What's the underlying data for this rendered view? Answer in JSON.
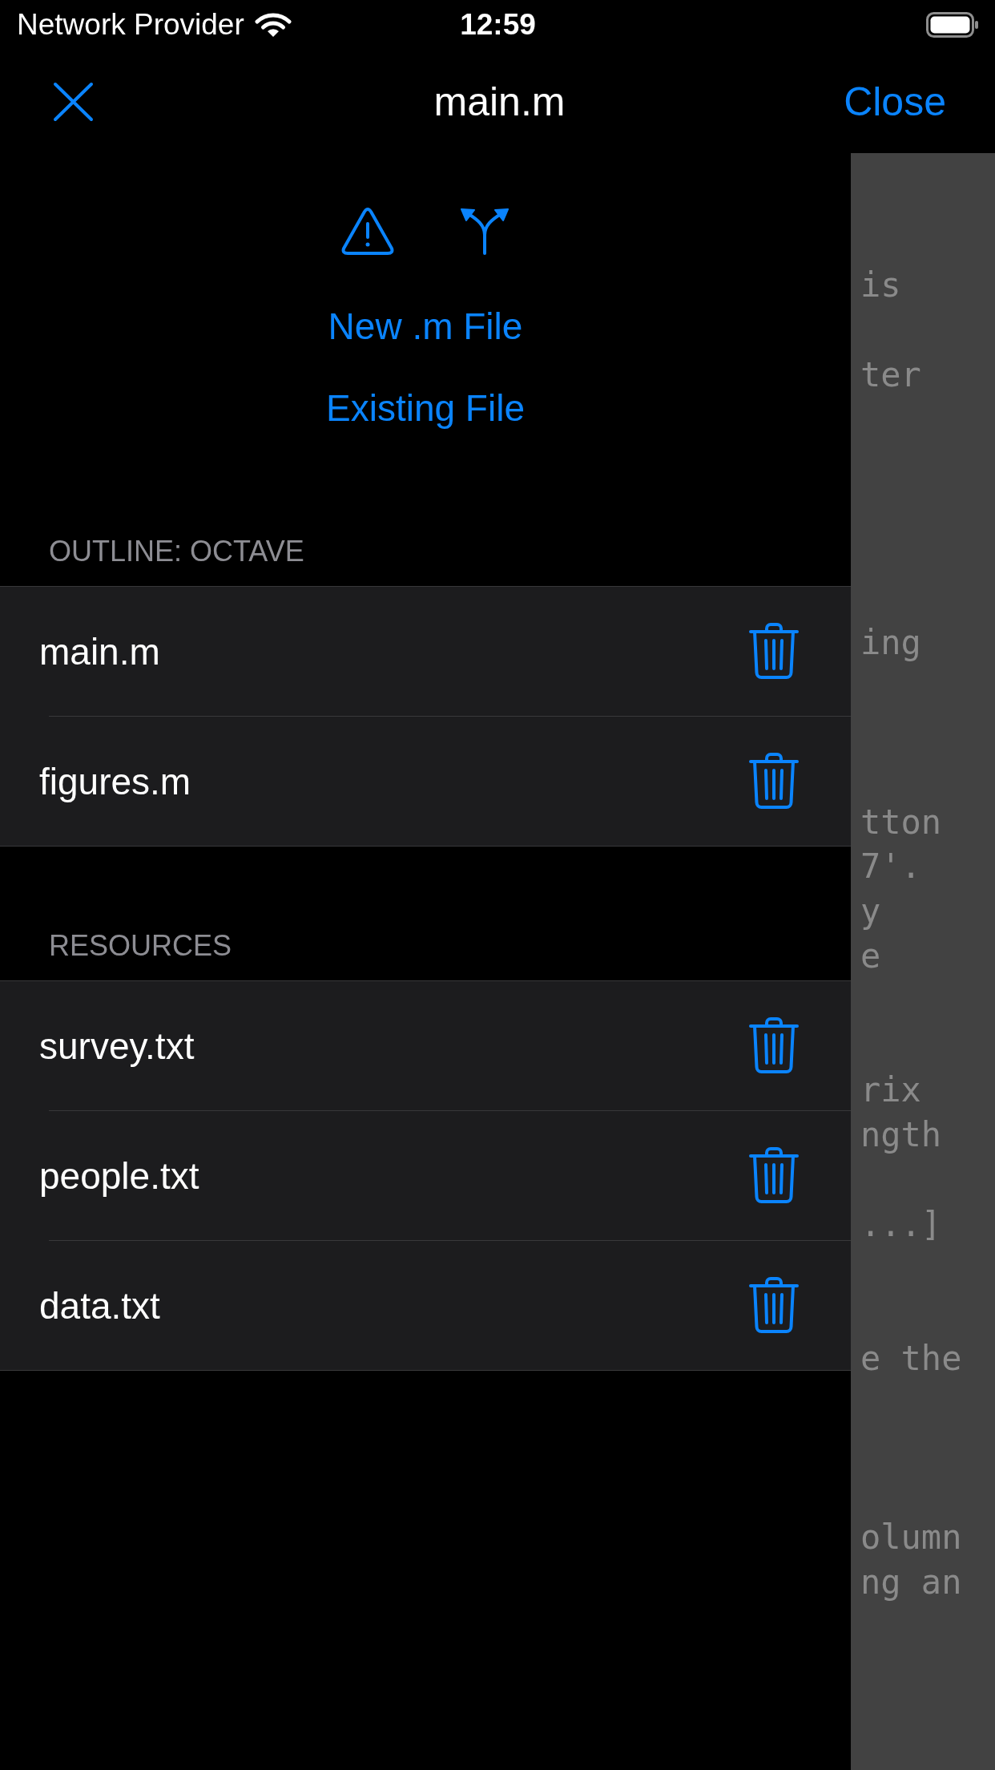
{
  "status_bar": {
    "carrier": "Network Provider",
    "time": "12:59"
  },
  "nav_bar": {
    "title": "main.m",
    "close_button": "Close"
  },
  "actions": [
    {
      "label": "New .m File"
    },
    {
      "label": "Existing File"
    }
  ],
  "sections": [
    {
      "header": "OUTLINE: OCTAVE",
      "items": [
        {
          "name": "main.m"
        },
        {
          "name": "figures.m"
        }
      ]
    },
    {
      "header": "RESOURCES",
      "items": [
        {
          "name": "survey.txt"
        },
        {
          "name": "people.txt"
        },
        {
          "name": "data.txt"
        }
      ]
    }
  ],
  "editor": {
    "code_text": "is\n\nter\n\n\n\n\n\ning\n\n\n\ntton\n7'.\ny\ne\n\n\nrix\nngth\n\n...]\n\n\ne the\n\n\n\nolumn\nng an"
  }
}
